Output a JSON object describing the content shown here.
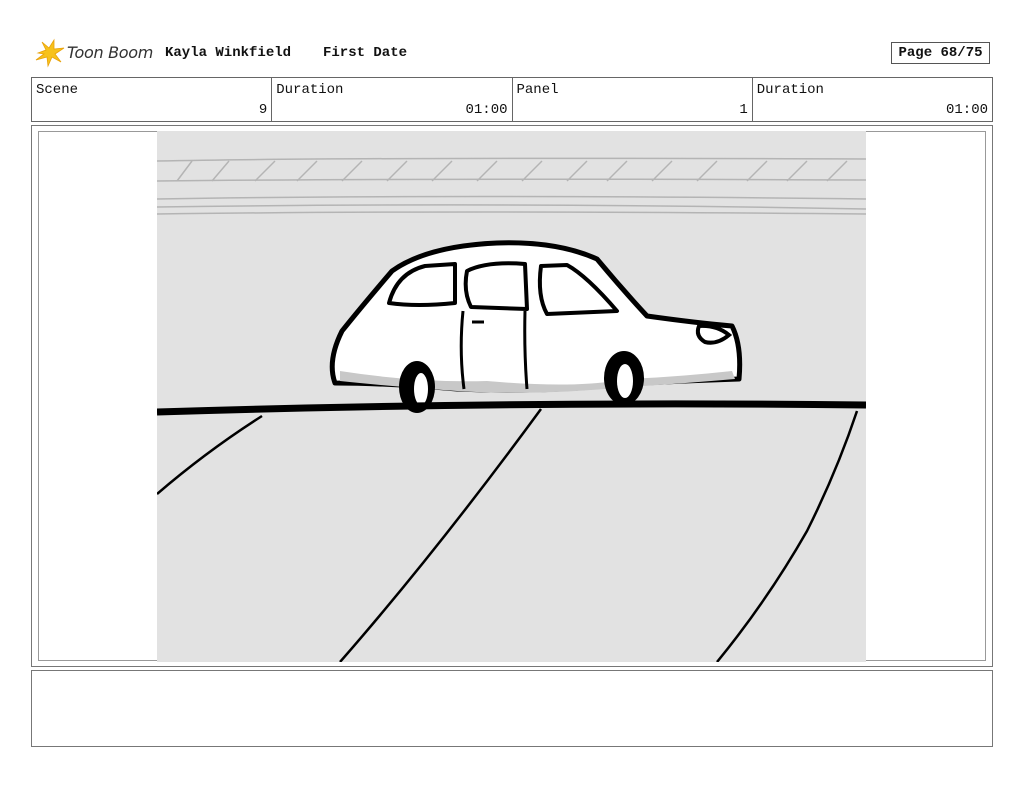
{
  "header": {
    "logo_text": "Toon Boom",
    "author": "Kayla Winkfield",
    "project_title": "First Date",
    "page": "Page 68/75"
  },
  "info": {
    "scene_label": "Scene",
    "scene_value": "9",
    "scene_duration_label": "Duration",
    "scene_duration_value": "01:00",
    "panel_label": "Panel",
    "panel_value": "1",
    "panel_duration_label": "Duration",
    "panel_duration_value": "01:00"
  },
  "panel": {
    "image_subject": "car-on-road-sketch"
  },
  "notes": {
    "text": ""
  }
}
